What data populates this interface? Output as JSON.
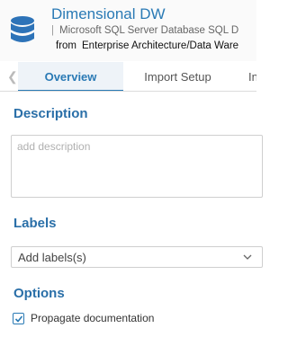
{
  "header": {
    "title": "Dimensional DW",
    "subtitle_separator": "|",
    "subtitle": "Microsoft SQL Server Database SQL D",
    "from_label": "from",
    "path": "Enterprise Architecture/Data Ware"
  },
  "tabs": [
    {
      "label": "Overview",
      "active": true
    },
    {
      "label": "Import Setup",
      "active": false
    },
    {
      "label": "In",
      "active": false
    }
  ],
  "description": {
    "title": "Description",
    "placeholder": "add description",
    "value": ""
  },
  "labels": {
    "title": "Labels",
    "placeholder": "Add labels(s)"
  },
  "options": {
    "title": "Options",
    "items": [
      {
        "label": "Propagate documentation",
        "checked": true
      }
    ]
  },
  "colors": {
    "accent": "#2a7ab5",
    "section_title": "#2a6fa8",
    "icon": "#2d73b8"
  },
  "icons": {
    "header_icon": "database-icon",
    "tab_scroll": "chevron-left-icon",
    "labels_dropdown": "chevron-down-icon",
    "checkbox": "checkmark-icon"
  }
}
